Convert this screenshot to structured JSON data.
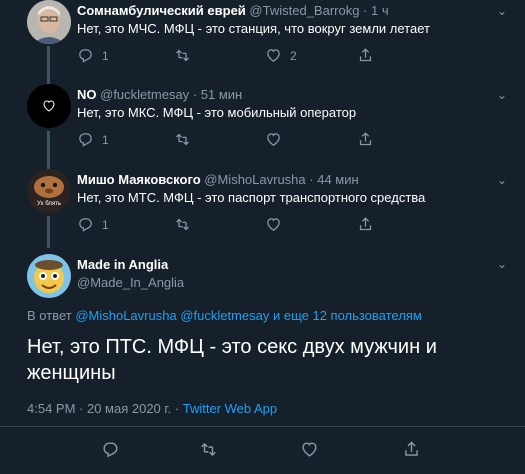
{
  "tweets": [
    {
      "name": "Сомнамбулический еврей",
      "handle": "@Twisted_Barrokg",
      "time": "1 ч",
      "text": "Нет, это МЧС. МФЦ - это станция, что вокруг земли летает",
      "replies": "1",
      "retweets": "",
      "likes": "2"
    },
    {
      "name": "NO",
      "handle": "@fuckletmesay",
      "time": "51 мин",
      "text": "Нет, это МКС. МФЦ - это мобильный оператор",
      "replies": "1",
      "retweets": "",
      "likes": ""
    },
    {
      "name": "Мишо Маяковского",
      "handle": "@MishoLavrusha",
      "time": "44 мин",
      "text": "Нет, это МТС. МФЦ - это паспорт транспортного средства",
      "replies": "1",
      "retweets": "",
      "likes": "",
      "avatar_caption": "Ух блять"
    }
  ],
  "main_tweet": {
    "name": "Made in Anglia",
    "handle": "@Made_In_Anglia",
    "reply_prefix": "В ответ",
    "reply_links": "@MishoLavrusha @fuckletmesay и еще 12 пользователям",
    "text": "Нет, это ПТС. МФЦ - это секс двух мужчин и женщины",
    "datetime": "4:54 PM · 20 мая 2020 г. · ",
    "source": "Twitter Web App"
  },
  "separator": "·",
  "chevron_glyph": "⌄",
  "icons": [
    "reply-icon",
    "retweet-icon",
    "like-icon",
    "share-icon",
    "chevron-down-icon"
  ],
  "colors": {
    "background": "#15202b",
    "link": "#1da1f2",
    "muted": "#8899a6"
  }
}
